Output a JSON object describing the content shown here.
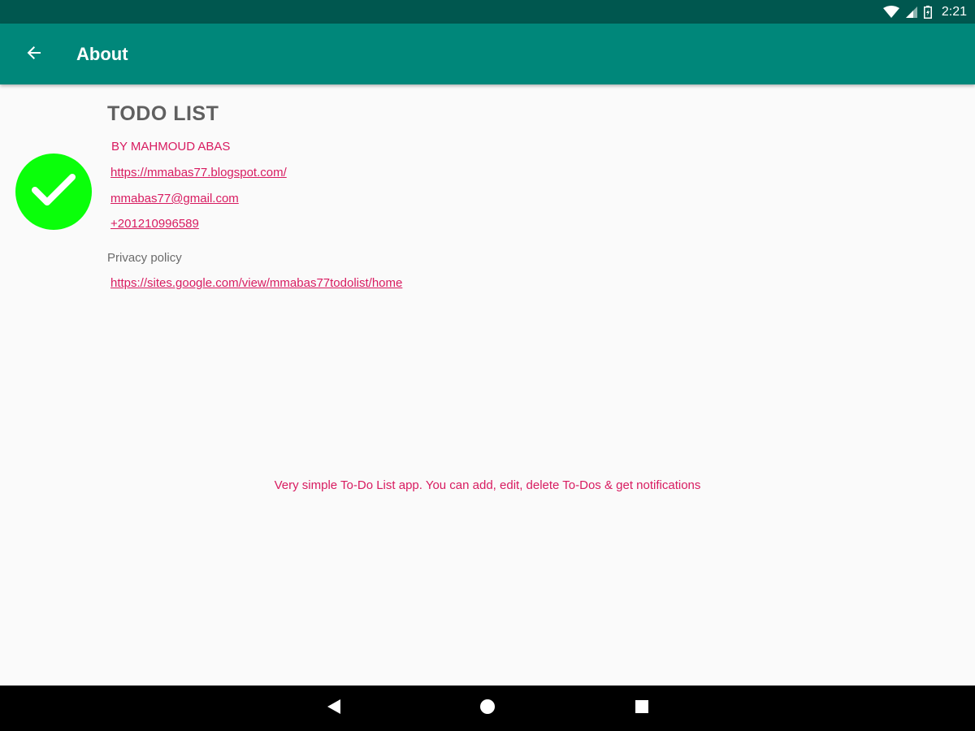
{
  "status_bar": {
    "time": "2:21",
    "icons": [
      "wifi-icon",
      "cell-signal-icon",
      "battery-icon"
    ]
  },
  "app_bar": {
    "title": "About",
    "back_icon": "arrow-back-icon"
  },
  "about": {
    "logo_icon": "checkmark-icon",
    "app_name": "TODO LIST",
    "author": "BY MAHMOUD ABAS",
    "website": "https://mmabas77.blogspot.com/",
    "email": "mmabas77@gmail.com",
    "phone": "+201210996589",
    "privacy_label": "Privacy policy",
    "privacy_url": "https://sites.google.com/view/mmabas77todolist/home",
    "description": "Very simple To-Do List app. You can add, edit, delete To-Dos & get notifications"
  },
  "nav_bar": {
    "icons": [
      "nav-back-icon",
      "nav-home-icon",
      "nav-recents-icon"
    ]
  },
  "colors": {
    "status_bar": "#00574f",
    "app_bar": "#00877a",
    "accent": "#d81b60",
    "logo": "#0aff0a",
    "background": "#fafafa"
  }
}
